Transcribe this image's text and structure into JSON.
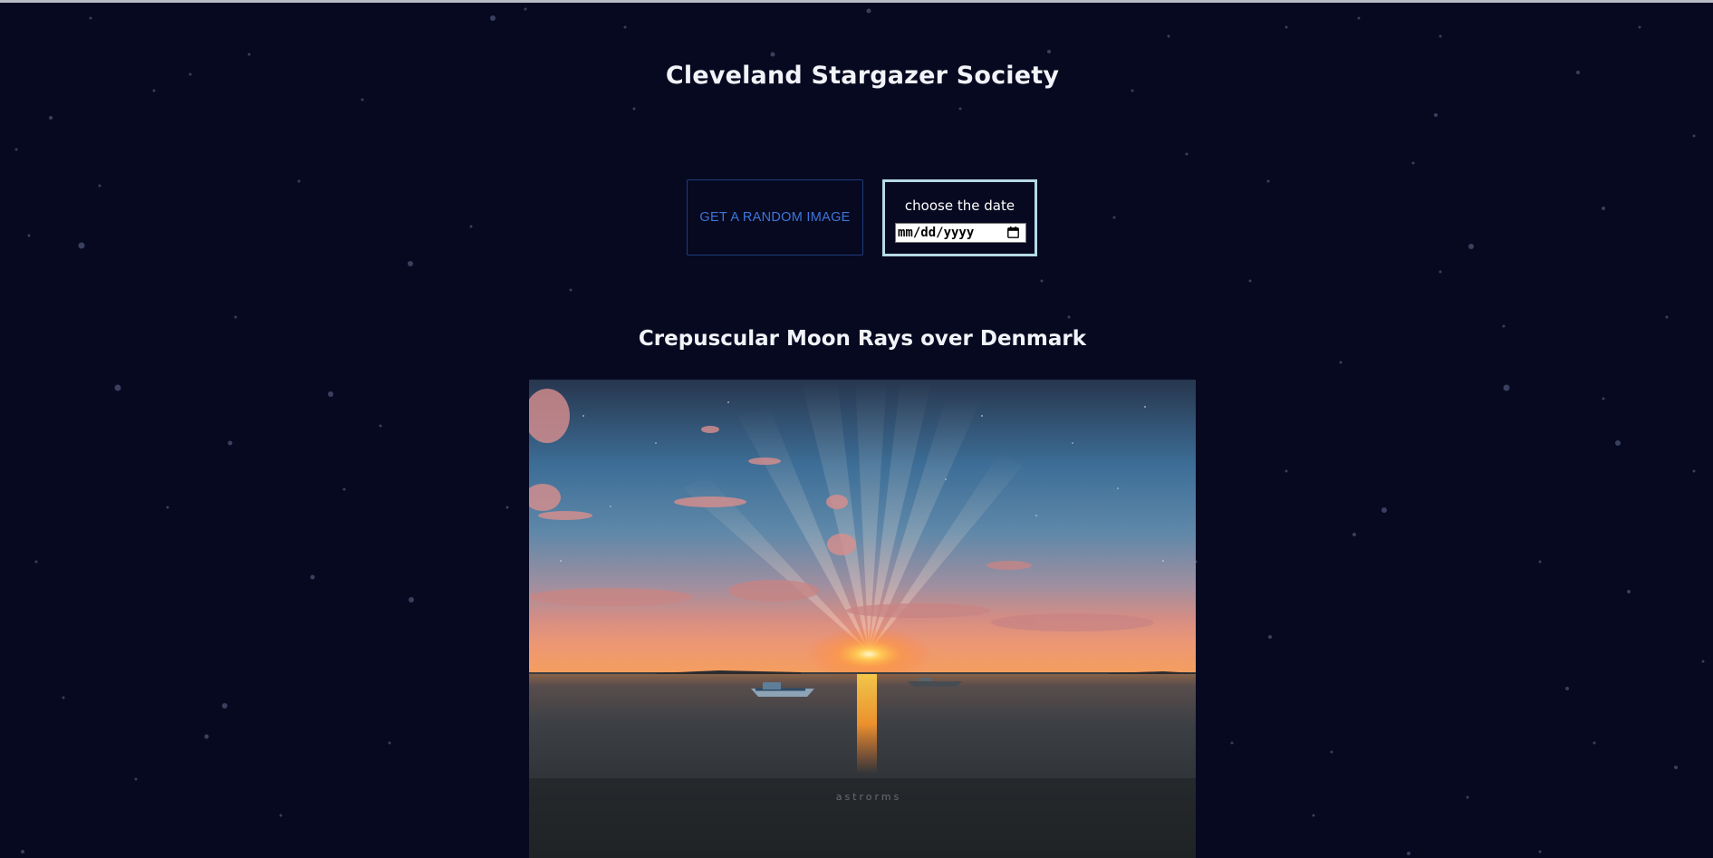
{
  "header": {
    "title": "Cleveland Stargazer Society"
  },
  "controls": {
    "random_button_label": "GET A RANDOM IMAGE",
    "date_label": "choose the date",
    "date_value": "mm/dd/yyyy"
  },
  "apod": {
    "title": "Crepuscular Moon Rays over Denmark",
    "image_watermark": "astrorms"
  },
  "icons": {
    "calendar": "calendar-icon"
  },
  "colors": {
    "background": "#070921",
    "title_text": "#f2f3f8",
    "button_text": "#3d76d9",
    "button_border": "#1f3d7c",
    "date_box_border": "#b6d9e7"
  }
}
